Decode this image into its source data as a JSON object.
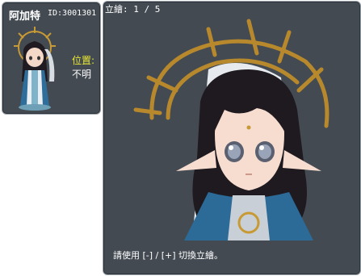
{
  "character": {
    "name": "阿加特",
    "id_text": "ID:3001301",
    "location_label": "位置:",
    "location_value": "不明"
  },
  "illustration": {
    "counter": "立繪: 1 / 5",
    "hint": "請使用 [-] / [+] 切換立繪。"
  },
  "colors": {
    "panel_bg": "#434a52",
    "label_yellow": "#e8e830",
    "text_white": "#ffffff"
  }
}
